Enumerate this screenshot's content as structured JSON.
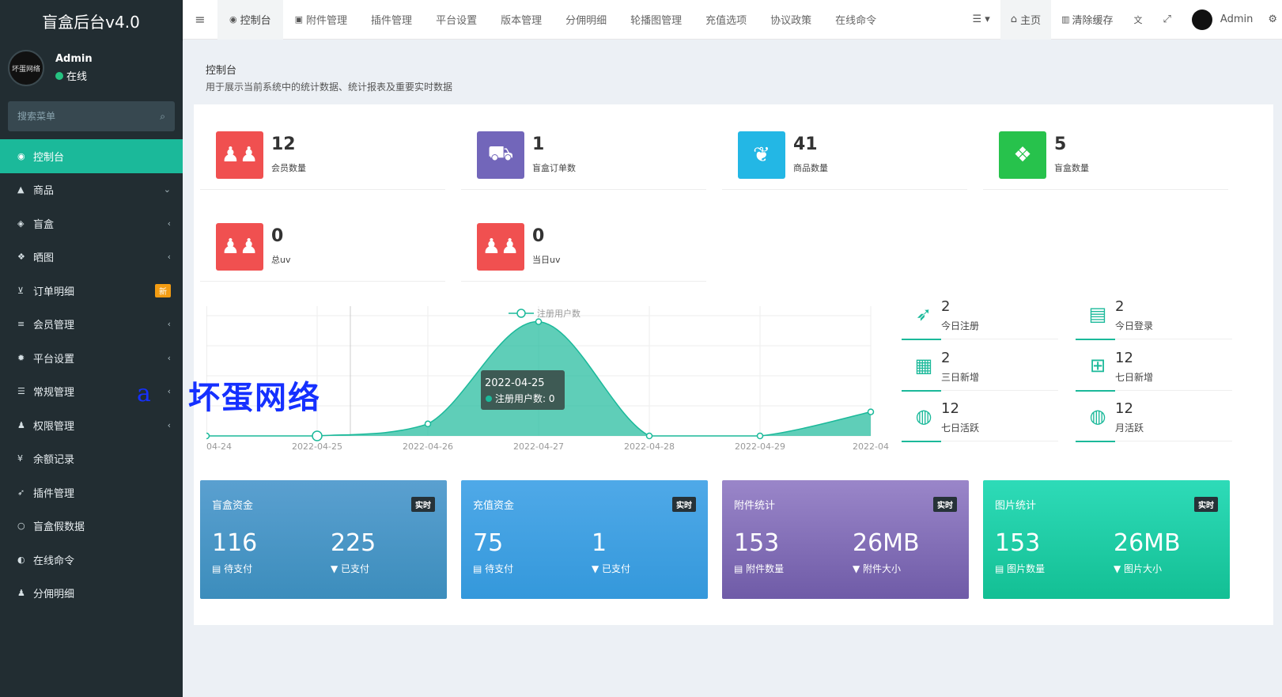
{
  "app": {
    "title": "盲盒后台v4.0"
  },
  "user": {
    "name": "Admin",
    "status": "在线",
    "avatar_text": "坏蛋网络"
  },
  "search": {
    "placeholder": "搜索菜单"
  },
  "sidebar": {
    "items": [
      {
        "label": "控制台",
        "icon": "dashboard-icon",
        "glyph": "◉",
        "arrow": ""
      },
      {
        "label": "商品",
        "icon": "shopping-bag-icon",
        "glyph": "▲",
        "arrow": "⌄"
      },
      {
        "label": "盲盒",
        "icon": "cube-icon",
        "glyph": "◈",
        "arrow": "‹"
      },
      {
        "label": "晒图",
        "icon": "dropbox-icon",
        "glyph": "❖",
        "arrow": "‹"
      },
      {
        "label": "订单明细",
        "icon": "cart-icon",
        "glyph": "⊻",
        "arrow": "",
        "badge": "新"
      },
      {
        "label": "会员管理",
        "icon": "list-icon",
        "glyph": "≡",
        "arrow": "‹"
      },
      {
        "label": "平台设置",
        "icon": "gear-icon",
        "glyph": "✹",
        "arrow": "‹"
      },
      {
        "label": "常规管理",
        "icon": "database-icon",
        "glyph": "☰",
        "arrow": "‹"
      },
      {
        "label": "权限管理",
        "icon": "users-icon",
        "glyph": "♟",
        "arrow": "‹"
      },
      {
        "label": "余额记录",
        "icon": "yen-icon",
        "glyph": "¥",
        "arrow": ""
      },
      {
        "label": "插件管理",
        "icon": "rocket-icon",
        "glyph": "➶",
        "arrow": ""
      },
      {
        "label": "盲盒假数据",
        "icon": "circle-icon",
        "glyph": "○",
        "arrow": ""
      },
      {
        "label": "在线命令",
        "icon": "adjust-icon",
        "glyph": "◐",
        "arrow": ""
      },
      {
        "label": "分佣明细",
        "icon": "users-icon",
        "glyph": "♟",
        "arrow": ""
      }
    ]
  },
  "topnav": {
    "tabs": [
      {
        "label": "控制台",
        "icon": "dashboard-icon",
        "glyph": "◉"
      },
      {
        "label": "附件管理",
        "icon": "file-image-icon",
        "glyph": "▣"
      },
      {
        "label": "插件管理",
        "icon": "",
        "glyph": ""
      },
      {
        "label": "平台设置",
        "icon": "",
        "glyph": ""
      },
      {
        "label": "版本管理",
        "icon": "",
        "glyph": ""
      },
      {
        "label": "分佣明细",
        "icon": "",
        "glyph": ""
      },
      {
        "label": "轮播图管理",
        "icon": "",
        "glyph": ""
      },
      {
        "label": "充值选项",
        "icon": "",
        "glyph": ""
      },
      {
        "label": "协议政策",
        "icon": "",
        "glyph": ""
      },
      {
        "label": "在线命令",
        "icon": "",
        "glyph": ""
      }
    ],
    "home": "主页",
    "clear_cache": "清除缓存",
    "admin": "Admin"
  },
  "header": {
    "title": "控制台",
    "subtitle": "用于展示当前系统中的统计数据、统计报表及重要实时数据"
  },
  "stats": [
    {
      "value": "12",
      "label": "会员数量",
      "icon": "users-icon",
      "color": "#f05050"
    },
    {
      "value": "1",
      "label": "盲盒订单数",
      "icon": "cart-icon",
      "color": "#7266ba"
    },
    {
      "value": "41",
      "label": "商品数量",
      "icon": "leaf-icon",
      "color": "#23b7e5"
    },
    {
      "value": "5",
      "label": "盲盒数量",
      "icon": "dropbox-icon",
      "color": "#27c24c"
    },
    {
      "value": "0",
      "label": "总uv",
      "icon": "users-icon",
      "color": "#f05050"
    },
    {
      "value": "0",
      "label": "当日uv",
      "icon": "users-icon",
      "color": "#f05050"
    }
  ],
  "kpis": [
    {
      "value": "2",
      "label": "今日注册",
      "icon": "rocket-icon"
    },
    {
      "value": "2",
      "label": "今日登录",
      "icon": "vcard-icon"
    },
    {
      "value": "2",
      "label": "三日新增",
      "icon": "calendar-icon"
    },
    {
      "value": "12",
      "label": "七日新增",
      "icon": "calendar-plus-icon"
    },
    {
      "value": "12",
      "label": "七日活跃",
      "icon": "user-circle-icon"
    },
    {
      "value": "12",
      "label": "月活跃",
      "icon": "user-circle-icon"
    }
  ],
  "panels": [
    {
      "title": "盲盒资金",
      "tag": "实时",
      "v1": "116",
      "l1": "待支付",
      "v2": "225",
      "l2": "已支付",
      "color1": "#5aa0d0",
      "color2": "#3c8dbc"
    },
    {
      "title": "充值资金",
      "tag": "实时",
      "v1": "75",
      "l1": "待支付",
      "v2": "1",
      "l2": "已支付",
      "color1": "#4fa9e8",
      "color2": "#3498db"
    },
    {
      "title": "附件统计",
      "tag": "实时",
      "v1": "153",
      "l1": "附件数量",
      "v2": "26MB",
      "l2": "附件大小",
      "color1": "#9a86c9",
      "color2": "#6f5ba7"
    },
    {
      "title": "图片统计",
      "tag": "实时",
      "v1": "153",
      "l1": "图片数量",
      "v2": "26MB",
      "l2": "图片大小",
      "color1": "#2edbb8",
      "color2": "#13bf94"
    }
  ],
  "chart_data": {
    "type": "area",
    "series": [
      {
        "name": "注册用户数",
        "values": [
          0,
          0,
          0.2,
          1.9,
          0,
          0,
          0.4
        ]
      }
    ],
    "categories": [
      "04-24",
      "2022-04-25",
      "2022-04-26",
      "2022-04-27",
      "2022-04-28",
      "2022-04-29",
      "2022-04"
    ],
    "ylim": [
      0,
      2
    ],
    "grid": true,
    "legend": "top-center",
    "color": "#1bb99a",
    "tooltip": {
      "title": "2022-04-25",
      "text": "注册用户数: 0"
    }
  },
  "watermark": {
    "text": "坏蛋网络",
    "mark": "a"
  }
}
